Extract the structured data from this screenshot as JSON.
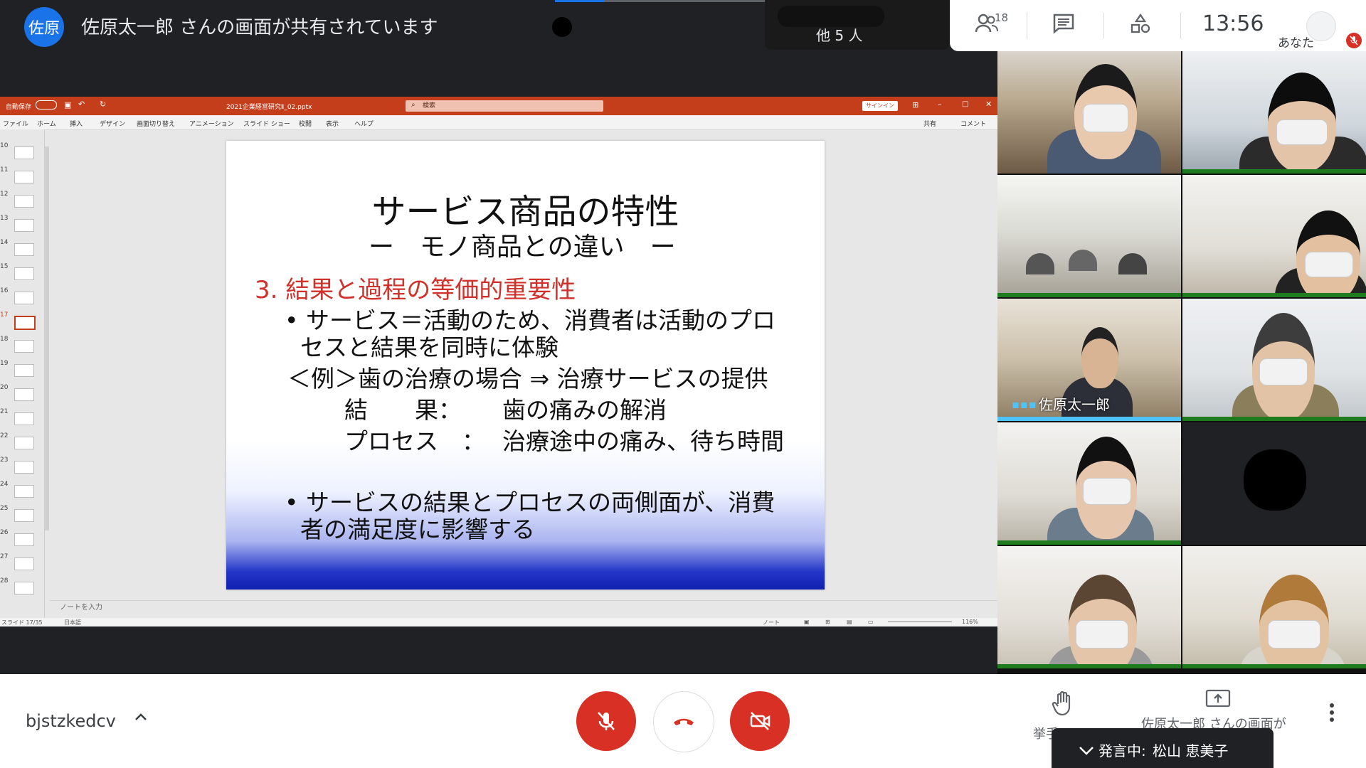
{
  "top": {
    "presenter_initials": "佐原",
    "sharing_text": "佐原太一郎 さんの画面が共有されています",
    "others_count": "他 5 人",
    "participants_count": "18",
    "clock": "13:56",
    "you_label": "あなた"
  },
  "powerpoint": {
    "autosave": "自動保存",
    "filename": "2021企業経営研究Ⅱ_02.pptx",
    "search_placeholder": "検索",
    "signin": "サインイン",
    "menu": [
      "ファイル",
      "ホーム",
      "挿入",
      "デザイン",
      "画面切り替え",
      "アニメーション",
      "スライド ショー",
      "校閲",
      "表示",
      "ヘルプ"
    ],
    "share": "共有",
    "comment": "コメント",
    "thumb_numbers": [
      "10",
      "11",
      "12",
      "13",
      "14",
      "15",
      "16",
      "17",
      "18",
      "19",
      "20",
      "21",
      "22",
      "23",
      "24",
      "25",
      "26",
      "27",
      "28"
    ],
    "selected_slide": "17",
    "notes_placeholder": "ノートを入力",
    "status_slide": "スライド 17/35",
    "status_lang": "日本語",
    "status_notes": "ノート",
    "zoom": "116%"
  },
  "slide": {
    "title": "サービス商品の特性",
    "subtitle": "ー　モノ商品との違い　ー",
    "heading": "3. 結果と過程の等価的重要性",
    "bullet1_line1": "• サービス＝活動のため、消費者は活動のプロ",
    "bullet1_line2": "セスと結果を同時に体験",
    "example": "＜例＞歯の治療の場合 ⇒ 治療サービスの提供",
    "result_label": "結　　果：",
    "result_value": "歯の痛みの解消",
    "process_label": "プロセス　：",
    "process_value": "治療途中の痛み、待ち時間",
    "bullet2_line1": "• サービスの結果とプロセスの両側面が、消費",
    "bullet2_line2": "者の満足度に影響する"
  },
  "participants": {
    "presenter_name": "佐原太一郎"
  },
  "bottom": {
    "meeting_code": "bjstzkedcv",
    "raise_hand": "挙手",
    "presenting_label": "佐原太一郎 さんの画面が",
    "speaking_prefix": "発言中: ",
    "speaking_name": "松山 恵美子"
  },
  "colors": {
    "accent_red": "#d93025",
    "ppt_red": "#c43e1c",
    "meet_blue": "#1a73e8"
  }
}
